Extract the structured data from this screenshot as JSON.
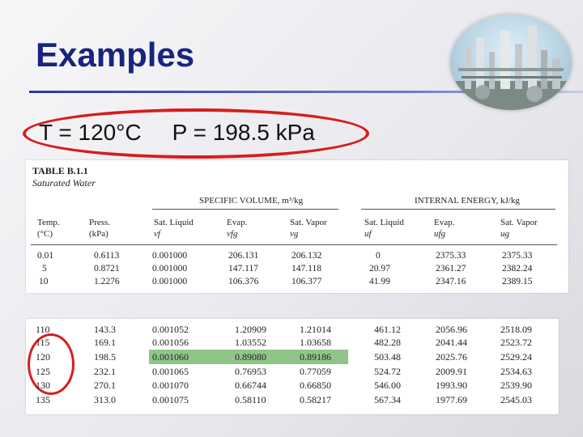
{
  "slide": {
    "title": "Examples",
    "conditions": {
      "temperature": "T = 120°C",
      "pressure": "P = 198.5 kPa"
    }
  },
  "table": {
    "name": "TABLE B.1.1",
    "subtitle": "Saturated Water",
    "groups": [
      "SPECIFIC VOLUME, m³/kg",
      "INTERNAL ENERGY, kJ/kg"
    ],
    "columns": [
      {
        "label": "Temp.",
        "sub": "(°C)"
      },
      {
        "label": "Press.",
        "sub": "(kPa)"
      },
      {
        "label": "Sat. Liquid",
        "sub": "vf"
      },
      {
        "label": "Evap.",
        "sub": "vfg"
      },
      {
        "label": "Sat. Vapor",
        "sub": "vg"
      },
      {
        "label": "Sat. Liquid",
        "sub": "uf"
      },
      {
        "label": "Evap.",
        "sub": "ufg"
      },
      {
        "label": "Sat. Vapor",
        "sub": "ug"
      }
    ],
    "top_rows": [
      [
        "0.01",
        "0.6113",
        "0.001000",
        "206.131",
        "206.132",
        "0",
        "2375.33",
        "2375.33"
      ],
      [
        "5",
        "0.8721",
        "0.001000",
        "147.117",
        "147.118",
        "20.97",
        "2361.27",
        "2382.24"
      ],
      [
        "10",
        "1.2276",
        "0.001000",
        "106.376",
        "106.377",
        "41.99",
        "2347.16",
        "2389.15"
      ]
    ],
    "bottom_rows": [
      [
        "110",
        "143.3",
        "0.001052",
        "1.20909",
        "1.21014",
        "461.12",
        "2056.96",
        "2518.09"
      ],
      [
        "115",
        "169.1",
        "0.001056",
        "1.03552",
        "1.03658",
        "482.28",
        "2041.44",
        "2523.72"
      ],
      [
        "120",
        "198.5",
        "0.001060",
        "0.89080",
        "0.89186",
        "503.48",
        "2025.76",
        "2529.24"
      ],
      [
        "125",
        "232.1",
        "0.001065",
        "0.76953",
        "0.77059",
        "524.72",
        "2009.91",
        "2534.63"
      ],
      [
        "130",
        "270.1",
        "0.001070",
        "0.66744",
        "0.66850",
        "546.00",
        "1993.90",
        "2539.90"
      ],
      [
        "135",
        "313.0",
        "0.001075",
        "0.58110",
        "0.58217",
        "567.34",
        "1977.69",
        "2545.03"
      ]
    ],
    "highlighted_row_index": 2
  },
  "colors": {
    "title": "#1a237e",
    "highlight_ellipse": "#d91c1c",
    "row_highlight": "#90c58a"
  },
  "icons": {
    "photo": "refinery-photo"
  }
}
